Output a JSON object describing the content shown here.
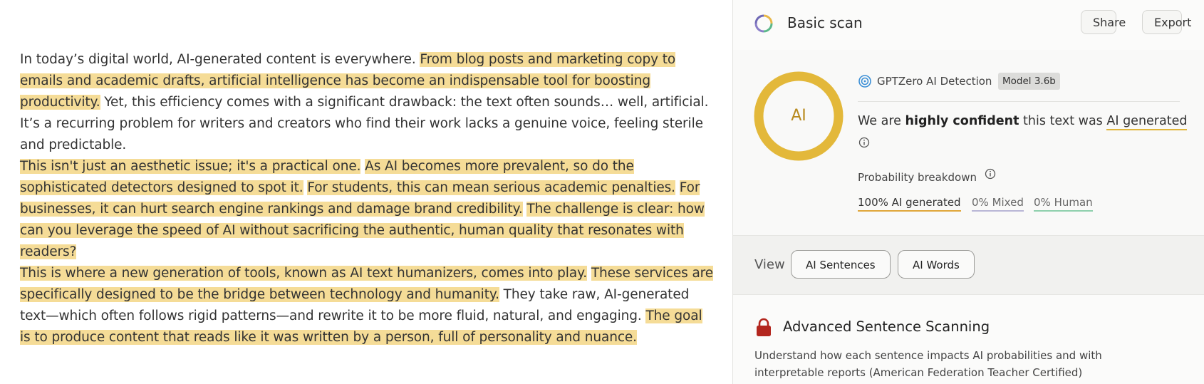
{
  "document": {
    "paragraphs": [
      [
        {
          "text": "In today’s digital world, AI-generated content is everywhere. ",
          "hl": false
        },
        {
          "text": "From blog posts and marketing copy to emails and academic drafts, artificial intelligence has become an indispensable tool for boosting productivity.",
          "hl": true
        },
        {
          "text": " Yet, this efficiency comes with a significant drawback: the text often sounds… well, artificial. It’s a recurring problem for writers and creators who find their work lacks a genuine voice, feeling sterile and predictable.",
          "hl": false
        }
      ],
      [
        {
          "text": "This isn't just an aesthetic issue; it's a practical one.",
          "hl": true
        },
        {
          "text": " ",
          "hl": false
        },
        {
          "text": "As AI becomes more prevalent, so do the sophisticated detectors designed to spot it.",
          "hl": true
        },
        {
          "text": " ",
          "hl": false
        },
        {
          "text": "For students, this can mean serious academic penalties.",
          "hl": true
        },
        {
          "text": " ",
          "hl": false
        },
        {
          "text": "For businesses, it can hurt search engine rankings and damage brand credibility.",
          "hl": true
        },
        {
          "text": " ",
          "hl": false
        },
        {
          "text": "The challenge is clear: how can you leverage the speed of AI without sacrificing the authentic, human quality that resonates with readers?",
          "hl": true
        }
      ],
      [
        {
          "text": "This is where a new generation of tools, known as AI text humanizers, comes into play.",
          "hl": true
        },
        {
          "text": " ",
          "hl": false
        },
        {
          "text": "These services are specifically designed to be the bridge between technology and humanity.",
          "hl": true
        },
        {
          "text": " They take raw, AI-generated text—which often follows rigid patterns—and rewrite it to be more fluid, natural, and engaging. ",
          "hl": false
        },
        {
          "text": "The goal is to produce content that reads like it was written by a person, full of personality and nuance.",
          "hl": true
        }
      ]
    ]
  },
  "panel": {
    "title": "Basic scan",
    "share_label": "Share",
    "export_label": "Export",
    "ring_label": "AI",
    "ring_fraction": 1.0,
    "detector_name": "GPTZero AI Detection",
    "model_badge": "Model 3.6b",
    "confidence_prefix": "We are ",
    "confidence_strong": "highly confident",
    "confidence_middle": " this text was ",
    "confidence_result": "AI generated",
    "probability_label": "Probability breakdown",
    "stats": {
      "ai": "100% AI generated",
      "mixed": "0% Mixed",
      "human": "0% Human"
    },
    "view_label": "View",
    "view_buttons": {
      "sentences": "AI Sentences",
      "words": "AI Words"
    },
    "advanced_title": "Advanced Sentence Scanning",
    "advanced_desc": "Understand how each sentence impacts AI probabilities and with interpretable reports (American Federation Teacher Certified)"
  },
  "colors": {
    "highlight": "#f5dc97",
    "ring": "#e3b83a",
    "ai_underline": "#e0a63a",
    "mixed_underline": "#b9b7d6",
    "human_underline": "#8fd0ad",
    "lock": "#b3261e"
  },
  "icons": {
    "logo": "circle-segments-icon",
    "detector": "target-icon",
    "info": "info-circle-icon",
    "lock": "lock-icon"
  }
}
